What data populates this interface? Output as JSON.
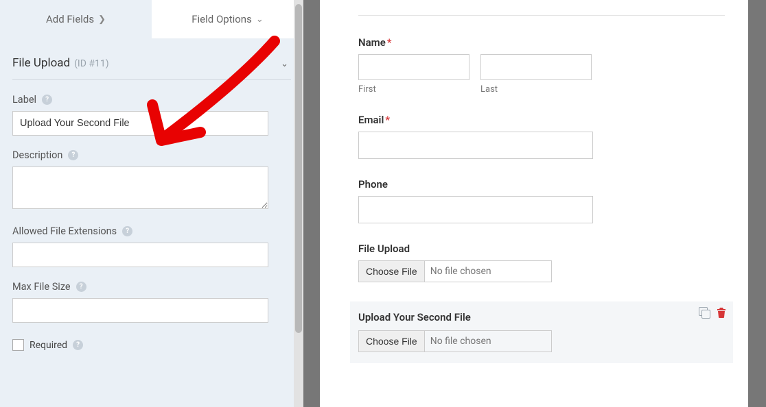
{
  "tabs": {
    "add_fields": "Add Fields",
    "field_options": "Field Options"
  },
  "panel": {
    "title": "File Upload",
    "id_label": "(ID #11)",
    "label": {
      "title": "Label",
      "value": "Upload Your Second File"
    },
    "description": {
      "title": "Description",
      "value": ""
    },
    "extensions": {
      "title": "Allowed File Extensions",
      "value": ""
    },
    "maxsize": {
      "title": "Max File Size",
      "value": ""
    },
    "required": {
      "title": "Required"
    }
  },
  "preview": {
    "name": {
      "label": "Name",
      "first_sub": "First",
      "last_sub": "Last"
    },
    "email": {
      "label": "Email"
    },
    "phone": {
      "label": "Phone"
    },
    "file1": {
      "label": "File Upload",
      "button": "Choose File",
      "placeholder": "No file chosen"
    },
    "file2": {
      "label": "Upload Your Second File",
      "button": "Choose File",
      "placeholder": "No file chosen"
    }
  }
}
